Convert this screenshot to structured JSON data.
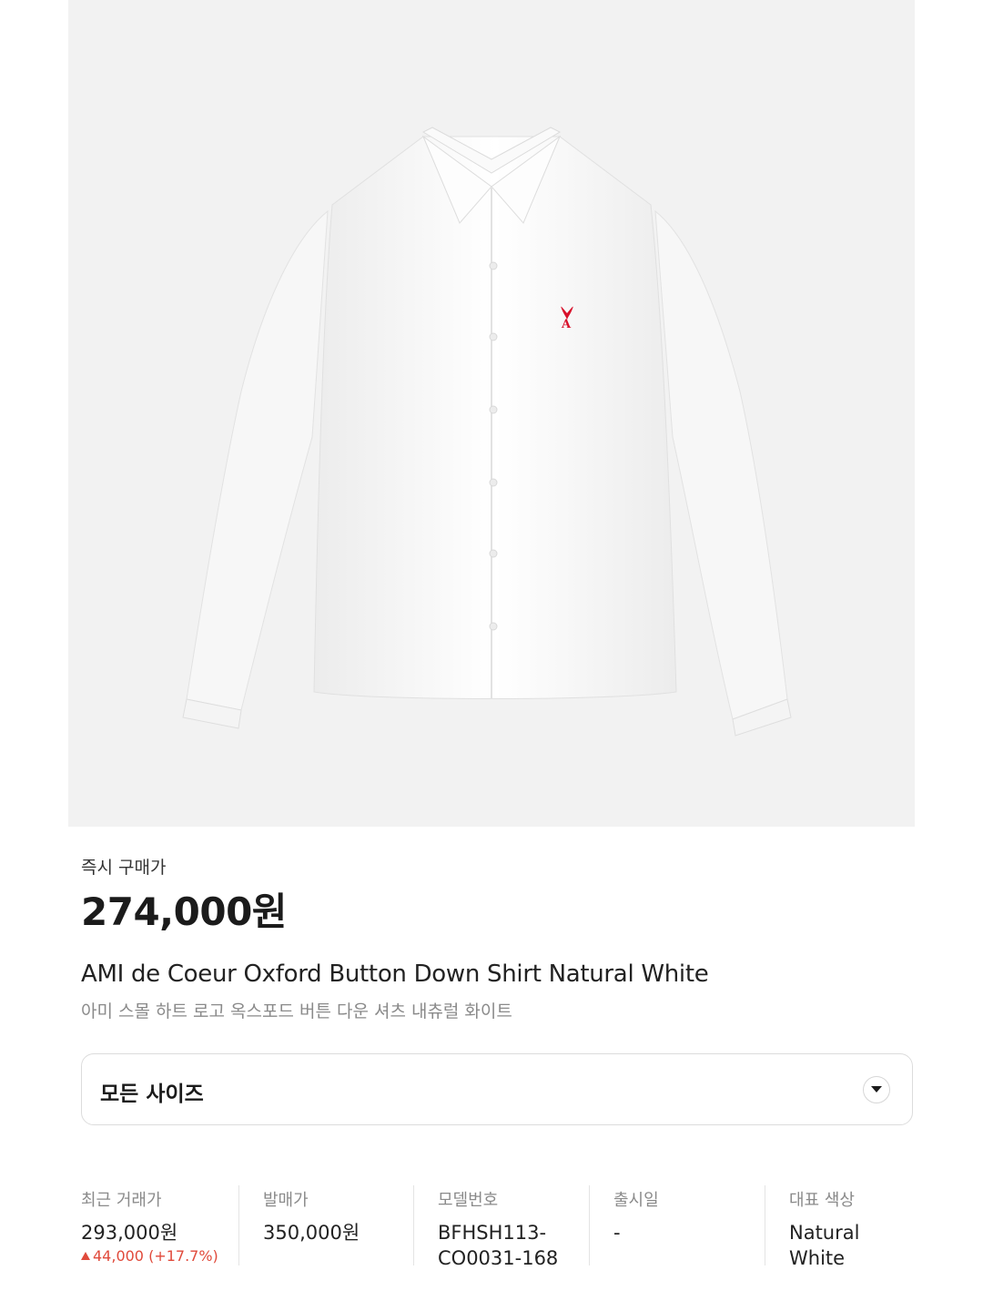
{
  "image": {
    "description_icon": "shirt-image"
  },
  "price": {
    "label": "즉시 구매가",
    "value": "274,000원"
  },
  "product": {
    "name_en": "AMI de Coeur Oxford Button Down Shirt Natural White",
    "name_ko": "아미 스몰 하트 로고 옥스포드 버튼 다운 셔츠 내츄럴 화이트"
  },
  "size_select": {
    "label": "모든 사이즈",
    "icon": "chevron-down-icon"
  },
  "stats": {
    "recent": {
      "label": "최근 거래가",
      "value": "293,000원",
      "change": "44,000 (+17.7%)",
      "change_color": "#e04a3b"
    },
    "release_price": {
      "label": "발매가",
      "value": "350,000원"
    },
    "model": {
      "label": "모델번호",
      "value_line1": "BFHSH113-",
      "value_line2": "CO0031-168"
    },
    "release_date": {
      "label": "출시일",
      "value": "-"
    },
    "color": {
      "label": "대표 색상",
      "value_line1": "Natural",
      "value_line2": "White"
    }
  }
}
